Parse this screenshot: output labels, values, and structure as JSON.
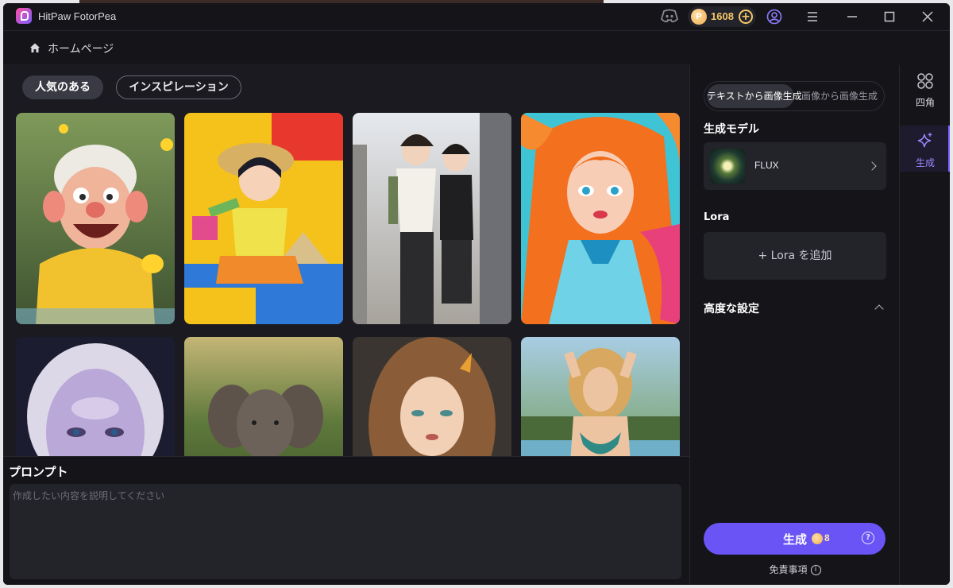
{
  "app": {
    "title": "HitPaw FotorPea",
    "coins": "1608",
    "coin_symbol": "P"
  },
  "breadcrumb": {
    "label": "ホームページ"
  },
  "gallery": {
    "chips": [
      "人気のある",
      "インスピレーション"
    ]
  },
  "prompt": {
    "title": "プロンプト",
    "placeholder": "作成したい内容を説明してください"
  },
  "panel": {
    "mode_tabs": [
      "テキストから画像生成",
      "画像から画像生成"
    ],
    "model_section": "生成モデル",
    "model_name": "FLUX",
    "lora_section": "Lora",
    "lora_add": "+ Lora を追加",
    "advanced": "高度な設定",
    "generate_label": "生成",
    "generate_cost": "8",
    "disclaimer": "免責事項",
    "info_glyph": "i",
    "help_glyph": "?"
  },
  "rail": {
    "items": [
      "四角",
      "生成"
    ]
  },
  "colors": {
    "accent": "#6a54f5",
    "coin": "#f6c768",
    "bg": "#141419"
  }
}
